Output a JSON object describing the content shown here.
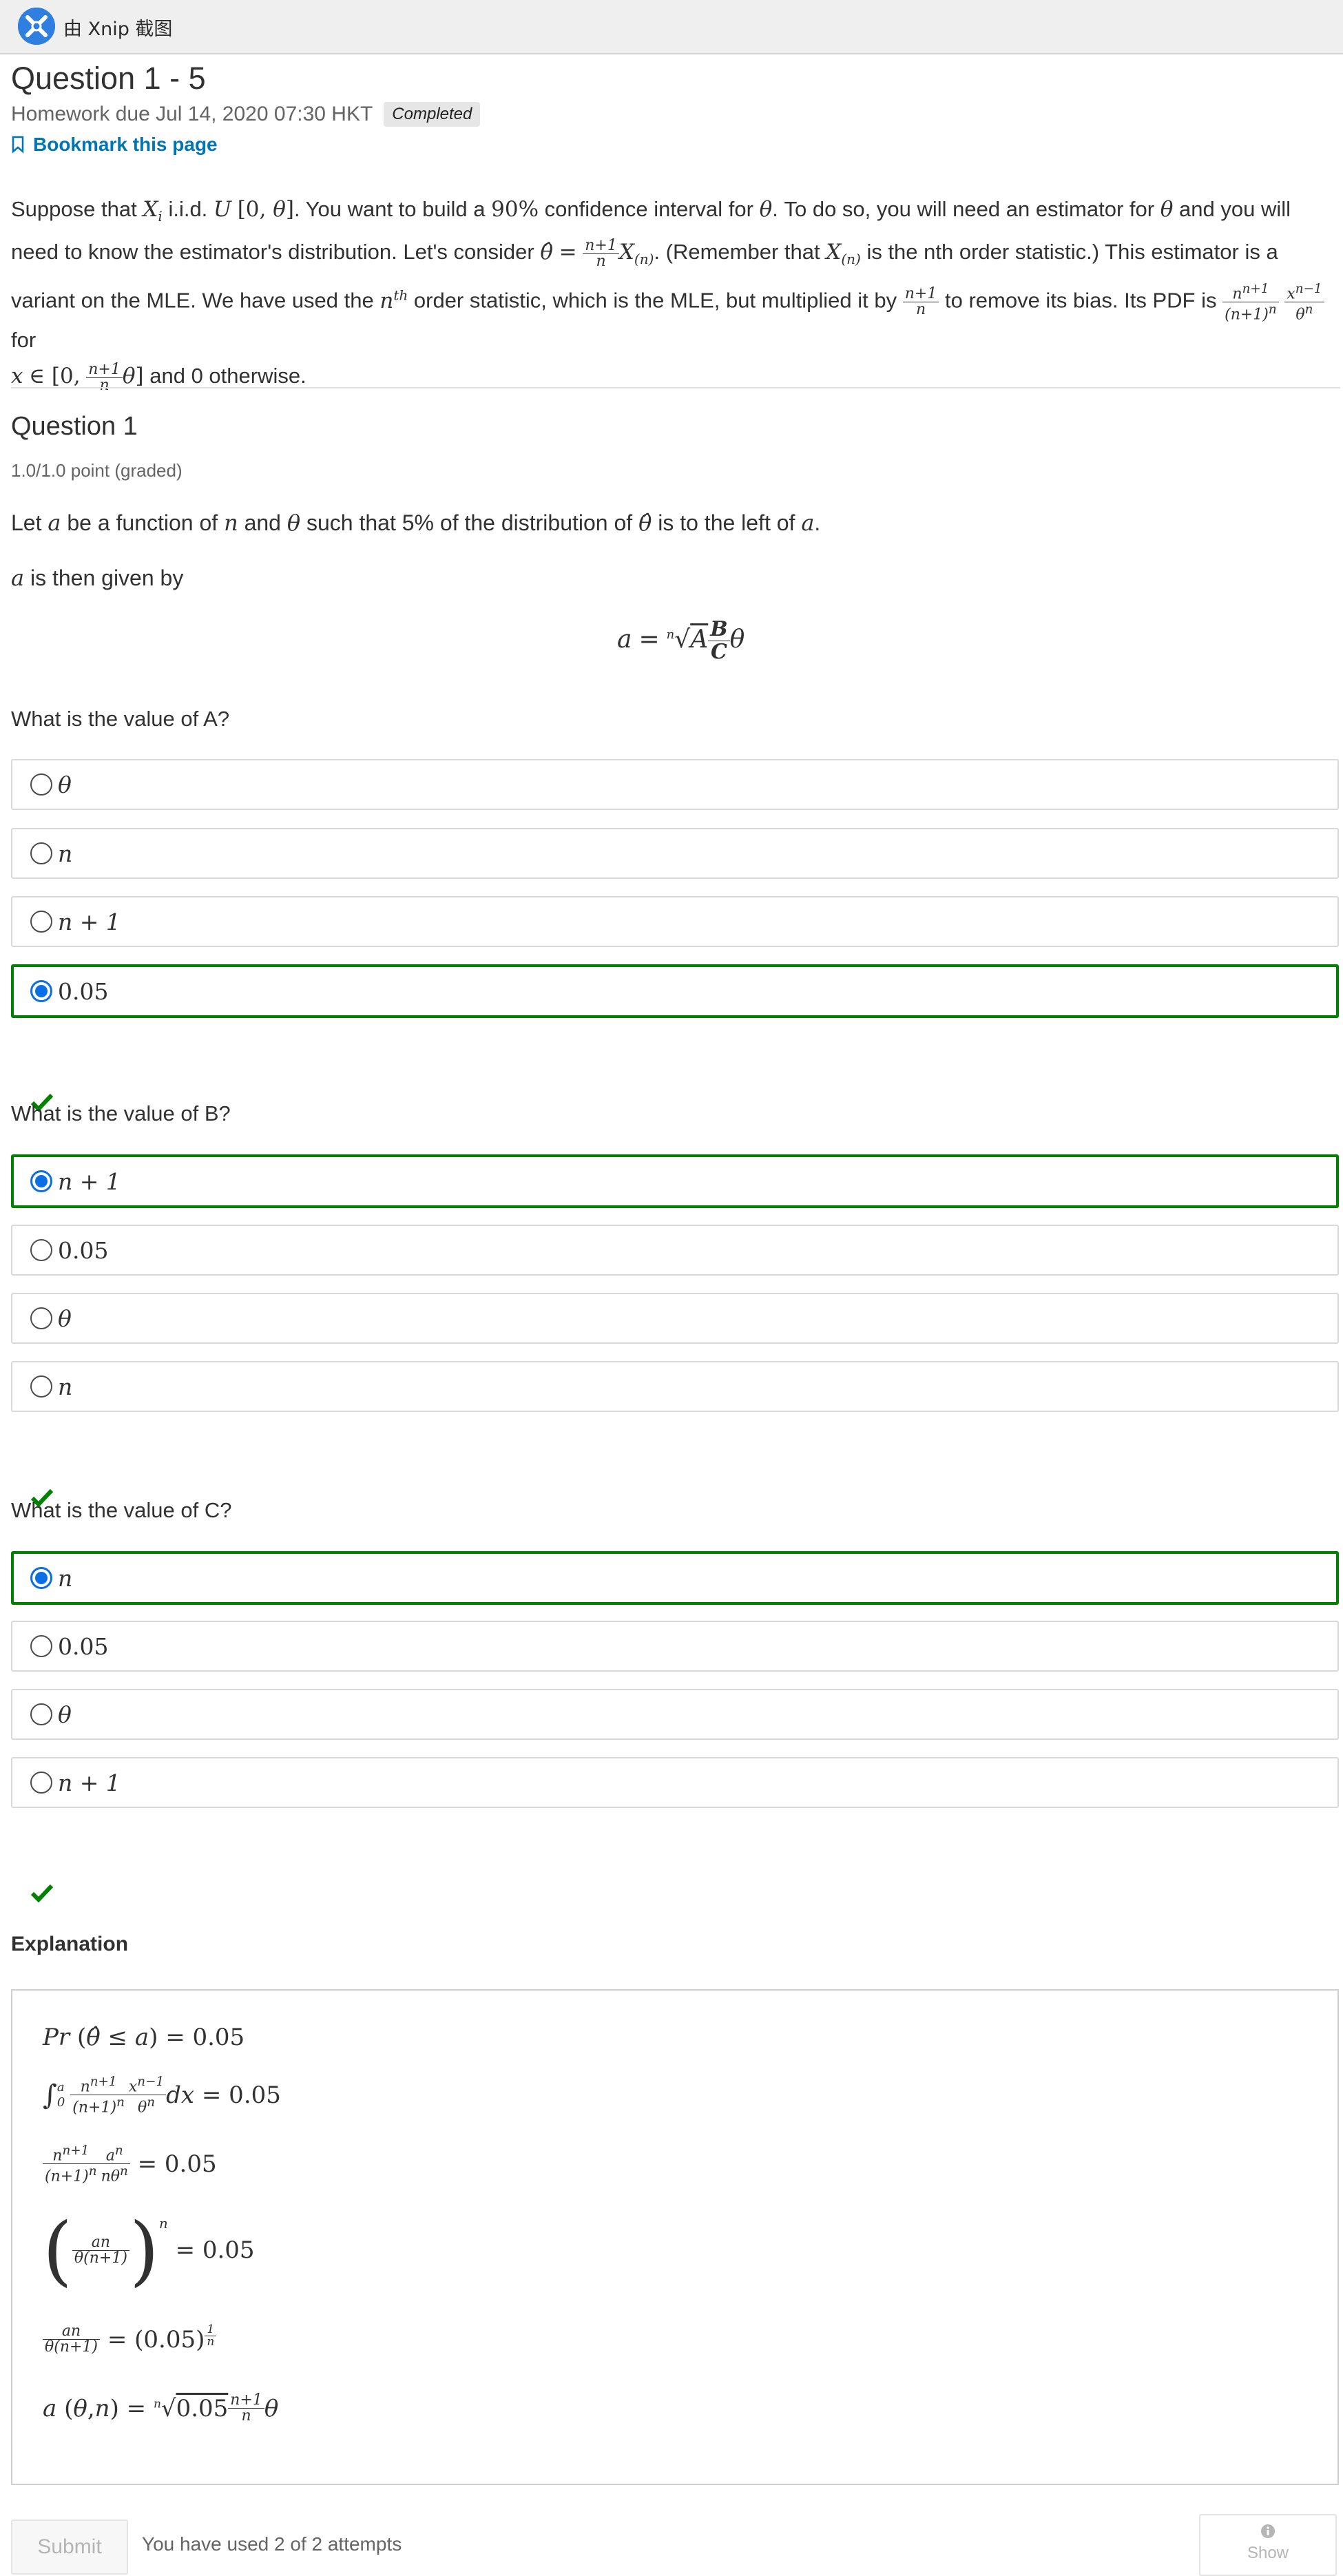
{
  "capture_bar": {
    "label": "由 Xnip 截图"
  },
  "header": {
    "title": "Question 1 - 5",
    "due": "Homework due Jul 14, 2020 07:30 HKT",
    "status": "Completed",
    "bookmark": "Bookmark this page"
  },
  "intro": {
    "p1": "Suppose that",
    "p2": "i.i.d.",
    "p3": ". You want to build a",
    "p4": "confidence interval for",
    "p5": ". To do so, you will need an estimator for",
    "p6": "and you will need to know the estimator's distribution. Let's consider",
    "p7": ". (Remember that",
    "p8": "is the nth order statistic.) This estimator is a variant on the MLE. We have used the",
    "p9": "order statistic, which is the MLE, but multiplied it by",
    "p10": "to remove its bias. Its PDF is",
    "p11": "for",
    "p12": "and 0 otherwise.",
    "percent": "90%"
  },
  "question": {
    "heading": "Question 1",
    "points": "1.0/1.0 point (graded)",
    "stem_1": "Let",
    "stem_2": "be a function of",
    "stem_3": "and",
    "stem_4": "such that 5% of the distribution of",
    "stem_5": "is to the left of",
    "given": "is then given by"
  },
  "parts": [
    {
      "prompt": "What is the value of A?",
      "choices": [
        "θ",
        "n",
        "n + 1",
        "0.05"
      ],
      "selected_index": 3,
      "correct": true
    },
    {
      "prompt": "What is the value of B?",
      "choices": [
        "n + 1",
        "0.05",
        "θ",
        "n"
      ],
      "selected_index": 0,
      "correct": true
    },
    {
      "prompt": "What is the value of C?",
      "choices": [
        "n",
        "0.05",
        "θ",
        "n + 1"
      ],
      "selected_index": 0,
      "correct": true
    }
  ],
  "explanation": {
    "title": "Explanation",
    "eq1_rhs": "= 0.05",
    "eq2_rhs": "= 0.05",
    "eq3_rhs": "= 0.05",
    "eq4_rhs": "= 0.05",
    "eq5_rhs": "= (0.05)"
  },
  "footer": {
    "submit": "Submit",
    "attempts": "You have used 2 of 2 attempts",
    "show": "Show"
  },
  "colors": {
    "correct_green": "#008100",
    "radio_blue": "#0a6ee6",
    "link_blue": "#0075b4"
  },
  "icons": [
    "xnip-logo-icon",
    "bookmark-icon",
    "checkmark-icon",
    "info-icon"
  ]
}
